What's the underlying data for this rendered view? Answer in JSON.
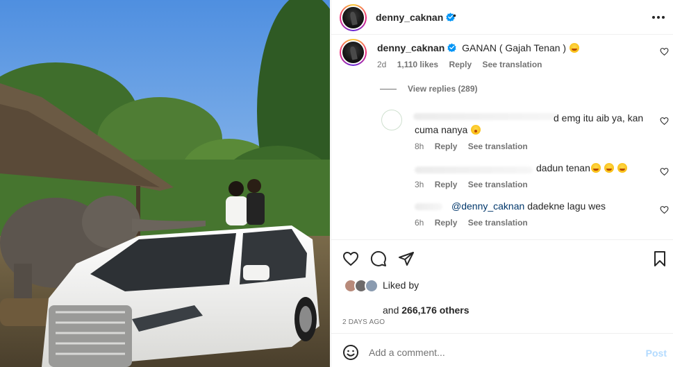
{
  "post": {
    "username": "denny_caknan",
    "verified": true,
    "header_dot": "•"
  },
  "comments": {
    "main": {
      "username": "denny_caknan",
      "text": "GANAN ( Gajah Tenan )",
      "emoji": "laughing-crying-emoji",
      "time": "2d",
      "likes": "1,110 likes",
      "reply_label": "Reply",
      "translate_label": "See translation"
    },
    "view_replies": "View replies (289)",
    "replies": [
      {
        "text_line1": "d emg itu aib ya, kan",
        "text_line2": "cuma nanya",
        "emoji": "surprised-emoji",
        "time": "8h",
        "reply_label": "Reply",
        "translate_label": "See translation"
      },
      {
        "text": "dadun tenan",
        "emoji": "grinning-emoji",
        "time": "3h",
        "reply_label": "Reply",
        "translate_label": "See translation"
      },
      {
        "mention": "@denny_caknan",
        "text": "dadekne lagu wes",
        "time": "6h",
        "reply_label": "Reply",
        "translate_label": "See translation"
      }
    ]
  },
  "actions": {
    "icons": [
      "heart-icon",
      "comment-icon",
      "share-icon",
      "bookmark-icon"
    ],
    "liked_by_label": "Liked by",
    "liked_others_prefix": "and",
    "liked_others_count": "266,176 others",
    "date": "2 DAYS AGO"
  },
  "add_comment": {
    "placeholder": "Add a comment...",
    "post_label": "Post"
  },
  "colors": {
    "text": "#262626",
    "muted": "#737373",
    "link": "#00376b",
    "post_disabled": "#b3dbff",
    "verified": "#0095f6"
  }
}
